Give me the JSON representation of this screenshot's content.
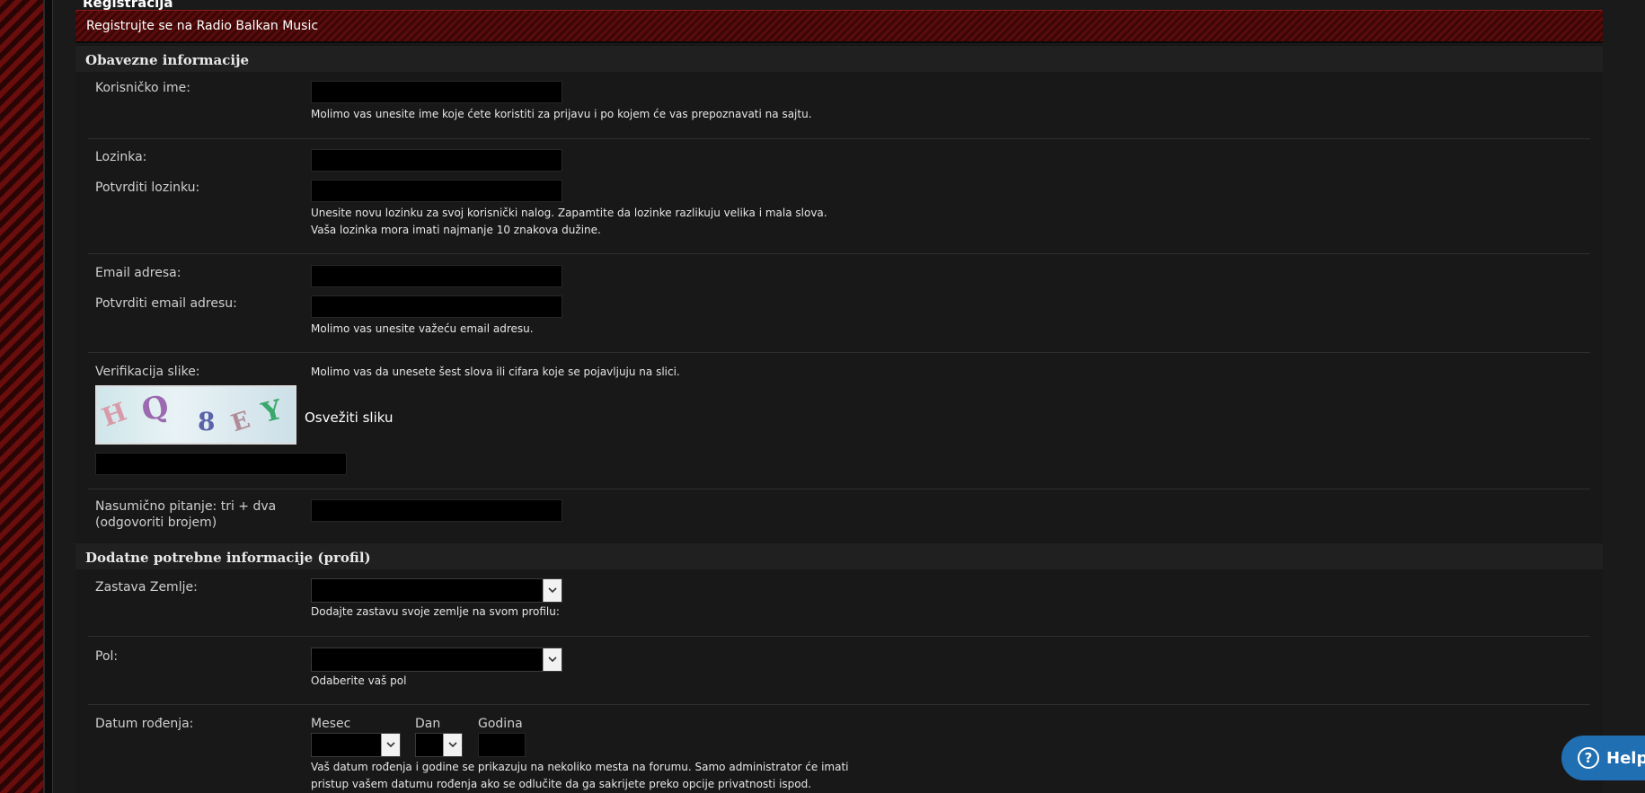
{
  "page_title": "Registracija",
  "banner": "Registrujte se na Radio Balkan Music",
  "section_required": "Obavezne informacije",
  "username": {
    "label": "Korisničko ime:",
    "hint": "Molimo vas unesite ime koje ćete koristiti za prijavu i po kojem će vas prepoznavati na sajtu."
  },
  "password": {
    "label": "Lozinka:",
    "confirm_label": "Potvrditi lozinku:",
    "hint1": "Unesite novu lozinku za svoj korisnički nalog. Zapamtite da lozinke razlikuju velika i mala slova.",
    "hint2": "Vaša lozinka mora imati najmanje 10 znakova dužine."
  },
  "email": {
    "label": "Email adresa:",
    "confirm_label": "Potvrditi email adresu:",
    "hint": "Molimo vas unesite važeću email adresu."
  },
  "captcha": {
    "label": "Verifikacija slike:",
    "hint": "Molimo vas da unesete šest slova ili cifara koje se pojavljuju na slici.",
    "refresh": "Osvežiti sliku",
    "chars": [
      "H",
      "Q",
      "8",
      "E",
      "Y"
    ]
  },
  "question": {
    "label_line1": "Nasumično pitanje: tri + dva",
    "label_line2": "(odgovoriti brojem)"
  },
  "section_profile": "Dodatne potrebne informacije (profil)",
  "flag": {
    "label": "Zastava Zemlje:",
    "hint": "Dodajte zastavu svoje zemlje na svom profilu:"
  },
  "gender": {
    "label": "Pol:",
    "hint": "Odaberite vaš pol"
  },
  "birthday": {
    "label": "Datum rođenja:",
    "month": "Mesec",
    "day": "Dan",
    "year": "Godina",
    "hint1": "Vaš datum rođenja i godine se prikazuju na nekoliko mesta na forumu. Samo administrator će imati",
    "hint2": "pristup vašem datumu rođenja ako se odlučite da ga sakrijete preko opcije privatnosti ispod."
  },
  "help": {
    "icon": "question-circle-icon",
    "label": "Help"
  }
}
